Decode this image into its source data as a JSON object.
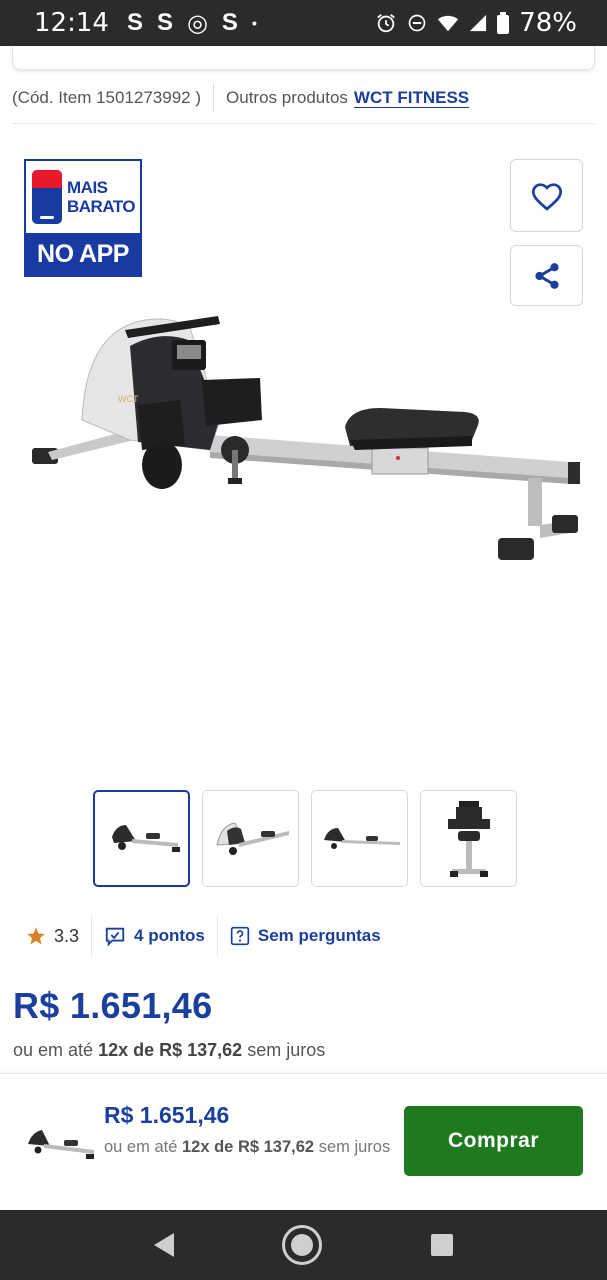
{
  "status_bar": {
    "time": "12:14",
    "app_icons": [
      "S",
      "S",
      "◎",
      "S",
      "•"
    ],
    "battery": "78%"
  },
  "item_info": {
    "code": "(Cód. Item 1501273992 )",
    "other_products_label": "Outros produtos",
    "brand_link": "WCT FITNESS"
  },
  "promo_badge": {
    "line1": "MAIS",
    "line2": "BARATO",
    "line3": "NO APP"
  },
  "icons": {
    "favorite": "heart-icon",
    "share": "share-icon",
    "star": "star-icon",
    "questions": "question-icon",
    "comments": "comment-icon"
  },
  "thumbnails": [
    {
      "name": "thumb-1",
      "active": true
    },
    {
      "name": "thumb-2",
      "active": false
    },
    {
      "name": "thumb-3",
      "active": false
    },
    {
      "name": "thumb-4",
      "active": false
    }
  ],
  "rating": {
    "value": "3.3",
    "points": "4 pontos",
    "questions": "Sem perguntas"
  },
  "price": {
    "main": "R$ 1.651,46",
    "installment_prefix": "ou em até",
    "installment_detail": "12x de R$ 137,62",
    "installment_suffix": "sem juros"
  },
  "buy_bar": {
    "price": "R$ 1.651,46",
    "installment_prefix": "ou em até",
    "installment_detail": "12x de R$ 137,62",
    "installment_suffix": "sem juros",
    "button_label": "Comprar"
  },
  "colors": {
    "brand_blue": "#1a3f9c",
    "buy_green": "#1f7a1f",
    "star_orange": "#d9822b",
    "promo_red": "#e8192c"
  }
}
